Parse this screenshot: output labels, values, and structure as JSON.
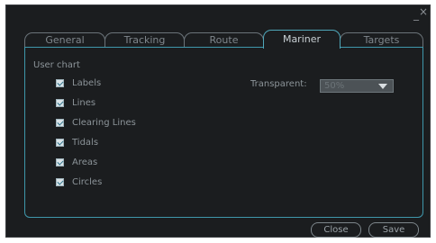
{
  "window": {
    "minimize_glyph": "_",
    "close_glyph": "×"
  },
  "tabs": [
    {
      "label": "General",
      "active": false
    },
    {
      "label": "Tracking",
      "active": false
    },
    {
      "label": "Route",
      "active": false
    },
    {
      "label": "Mariner",
      "active": true
    },
    {
      "label": "Targets",
      "active": false
    }
  ],
  "section": {
    "label": "User chart"
  },
  "checkboxes": [
    {
      "label": "Labels",
      "checked": true
    },
    {
      "label": "Lines",
      "checked": true
    },
    {
      "label": "Clearing Lines",
      "checked": true
    },
    {
      "label": "Tidals",
      "checked": true
    },
    {
      "label": "Areas",
      "checked": true
    },
    {
      "label": "Circles",
      "checked": true
    }
  ],
  "transparent": {
    "label": "Transparent:",
    "value": "50%"
  },
  "buttons": {
    "close": "Close",
    "save": "Save"
  },
  "colors": {
    "background": "#1b1d1f",
    "accent": "#3f97ab",
    "text": "#8c9499"
  }
}
